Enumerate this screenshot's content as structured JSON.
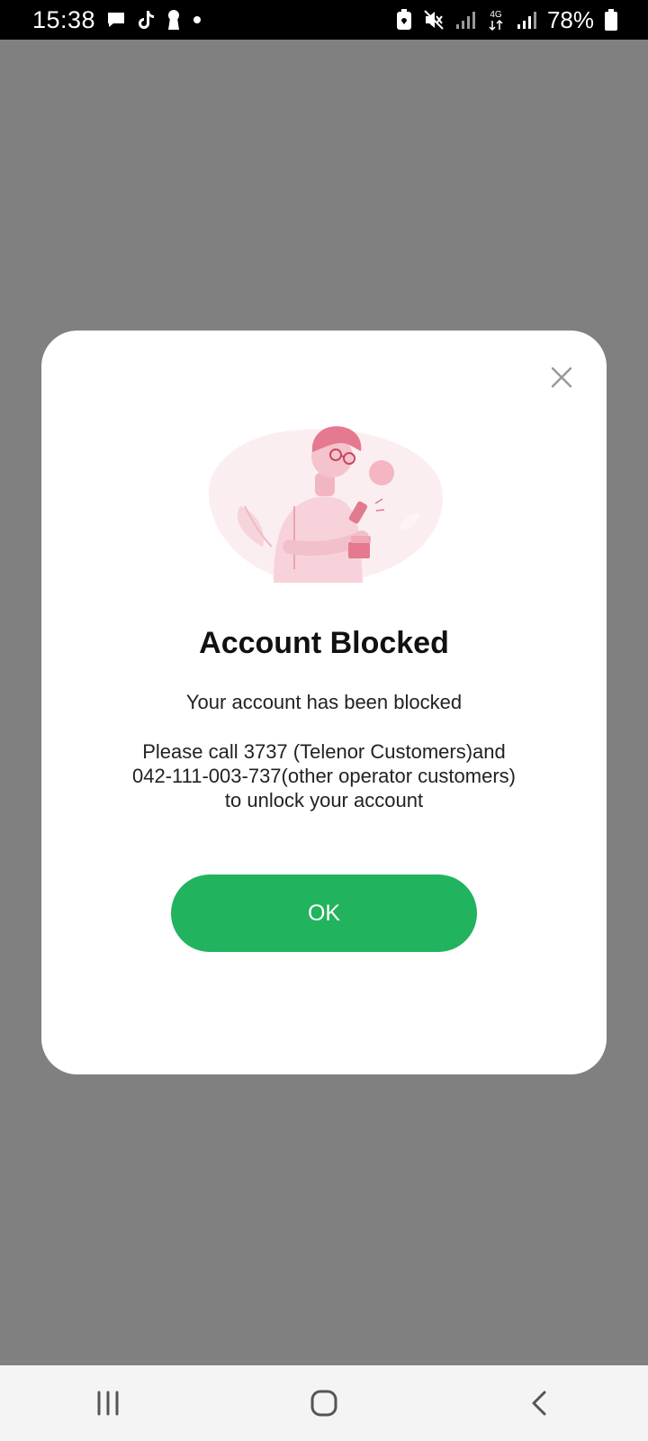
{
  "status_bar": {
    "time": "15:38",
    "battery_percent": "78%",
    "network_label": "4G",
    "left_icons": [
      "message-icon",
      "tiktok-icon",
      "keyhole-icon",
      "dot-icon"
    ],
    "right_icons": [
      "battery-saver-icon",
      "mute-icon",
      "signal-icon",
      "network-4g-icon",
      "signal-icon",
      "battery-icon"
    ]
  },
  "dialog": {
    "title": "Account Blocked",
    "subtitle": "Your account has been blocked",
    "message_lines": [
      "Please call 3737 (Telenor Customers)and",
      "042-111-003-737(other operator customers)",
      "to unlock your account"
    ],
    "ok_label": "OK",
    "ok_color": "#22b35e"
  },
  "nav_bar": {
    "buttons": [
      "recents-icon",
      "home-icon",
      "back-icon"
    ]
  }
}
